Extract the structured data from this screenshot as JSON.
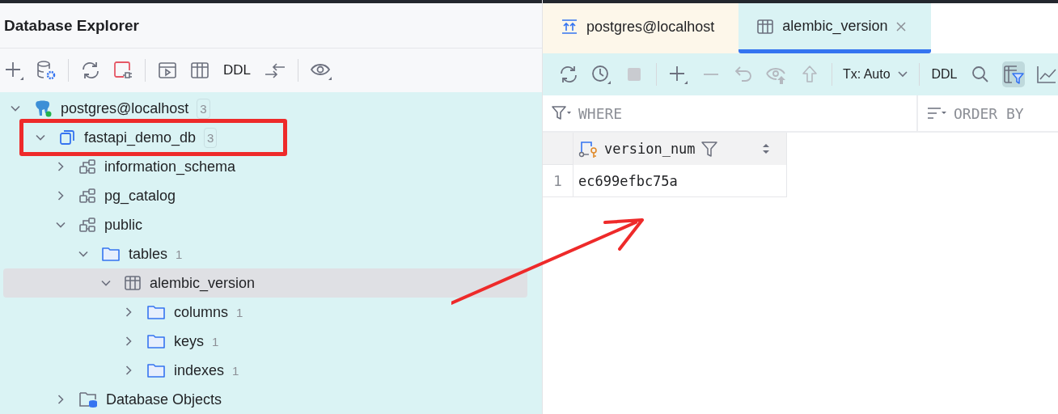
{
  "explorer": {
    "title": "Database Explorer",
    "toolbar": [
      {
        "kind": "add"
      },
      {
        "kind": "db-settings"
      },
      {
        "kind": "sep"
      },
      {
        "kind": "refresh"
      },
      {
        "kind": "disconnect"
      },
      {
        "kind": "sep"
      },
      {
        "kind": "console"
      },
      {
        "kind": "table"
      },
      {
        "kind": "text",
        "label": "DDL"
      },
      {
        "kind": "compare"
      },
      {
        "kind": "sep"
      },
      {
        "kind": "eye"
      }
    ],
    "tree": [
      {
        "kind": "connection",
        "label": "postgres@localhost",
        "count": "3",
        "expanded": true,
        "selected": false,
        "highlighted": false,
        "children": [
          {
            "kind": "database",
            "label": "fastapi_demo_db",
            "count": "3",
            "expanded": true,
            "selected": false,
            "highlighted": true,
            "children": [
              {
                "kind": "schema",
                "label": "information_schema",
                "expanded": false,
                "selected": false,
                "highlighted": false
              },
              {
                "kind": "schema",
                "label": "pg_catalog",
                "expanded": false,
                "selected": false,
                "highlighted": false
              },
              {
                "kind": "schema",
                "label": "public",
                "expanded": true,
                "selected": false,
                "highlighted": false,
                "children": [
                  {
                    "kind": "folder",
                    "label": "tables",
                    "count": "1",
                    "expanded": true,
                    "selected": false,
                    "highlighted": false,
                    "children": [
                      {
                        "kind": "table",
                        "label": "alembic_version",
                        "expanded": true,
                        "selected": true,
                        "highlighted": false,
                        "children": [
                          {
                            "kind": "folder",
                            "label": "columns",
                            "count": "1",
                            "expanded": false,
                            "selected": false,
                            "highlighted": false
                          },
                          {
                            "kind": "folder",
                            "label": "keys",
                            "count": "1",
                            "expanded": false,
                            "selected": false,
                            "highlighted": false
                          },
                          {
                            "kind": "folder",
                            "label": "indexes",
                            "count": "1",
                            "expanded": false,
                            "selected": false,
                            "highlighted": false
                          }
                        ]
                      }
                    ]
                  }
                ]
              },
              {
                "kind": "objects",
                "label": "Database Objects",
                "expanded": false,
                "selected": false,
                "highlighted": false
              }
            ]
          }
        ]
      }
    ]
  },
  "tabs": [
    {
      "kind": "console",
      "label": "postgres@localhost",
      "selected": false,
      "closable": false
    },
    {
      "kind": "table",
      "label": "alembic_version",
      "selected": true,
      "closable": true
    }
  ],
  "data_toolbar": [
    {
      "kind": "refresh",
      "disabled": false,
      "on": false
    },
    {
      "kind": "history",
      "disabled": false,
      "on": false
    },
    {
      "kind": "stop",
      "disabled": true,
      "on": false
    },
    {
      "kind": "sep"
    },
    {
      "kind": "add",
      "disabled": false,
      "on": false
    },
    {
      "kind": "remove",
      "disabled": true,
      "on": false
    },
    {
      "kind": "revert",
      "disabled": true,
      "on": false
    },
    {
      "kind": "preview",
      "disabled": true,
      "on": false
    },
    {
      "kind": "submit",
      "disabled": true,
      "on": false
    },
    {
      "kind": "sep"
    },
    {
      "kind": "dropdown",
      "label": "Tx: Auto"
    },
    {
      "kind": "sep"
    },
    {
      "kind": "text",
      "label": "DDL"
    },
    {
      "kind": "search",
      "disabled": false,
      "on": false
    },
    {
      "kind": "filter-toggle",
      "disabled": false,
      "on": true
    },
    {
      "kind": "chart",
      "disabled": false,
      "on": false
    }
  ],
  "filter": {
    "where_placeholder": "WHERE",
    "order_placeholder": "ORDER BY"
  },
  "grid": {
    "columns": [
      {
        "name": "version_num"
      }
    ],
    "rows": [
      {
        "number": "1",
        "cells": [
          "ec699efbc75a"
        ]
      }
    ]
  }
}
